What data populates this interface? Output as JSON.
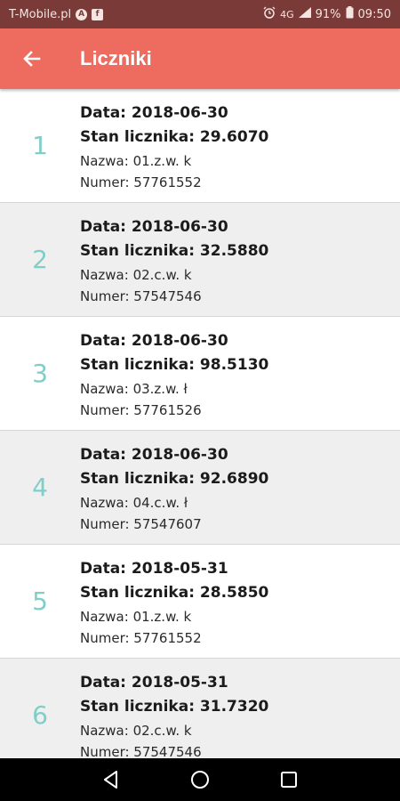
{
  "status_bar": {
    "carrier": "T-Mobile.pl",
    "battery": "91%",
    "time": "09:50",
    "network": "4G"
  },
  "app_bar": {
    "title": "Liczniki"
  },
  "labels": {
    "date": "Data: ",
    "reading": "Stan licznika: ",
    "name": "Nazwa: ",
    "number": "Numer: "
  },
  "readings": [
    {
      "index": "1",
      "date": "2018-06-30",
      "reading": "29.6070",
      "name": "01.z.w. k",
      "number": "57761552"
    },
    {
      "index": "2",
      "date": "2018-06-30",
      "reading": "32.5880",
      "name": "02.c.w. k",
      "number": "57547546"
    },
    {
      "index": "3",
      "date": "2018-06-30",
      "reading": "98.5130",
      "name": "03.z.w. ł",
      "number": "57761526"
    },
    {
      "index": "4",
      "date": "2018-06-30",
      "reading": "92.6890",
      "name": "04.c.w. ł",
      "number": "57547607"
    },
    {
      "index": "5",
      "date": "2018-05-31",
      "reading": "28.5850",
      "name": "01.z.w. k",
      "number": "57761552"
    },
    {
      "index": "6",
      "date": "2018-05-31",
      "reading": "31.7320",
      "name": "02.c.w. k",
      "number": "57547546"
    }
  ]
}
